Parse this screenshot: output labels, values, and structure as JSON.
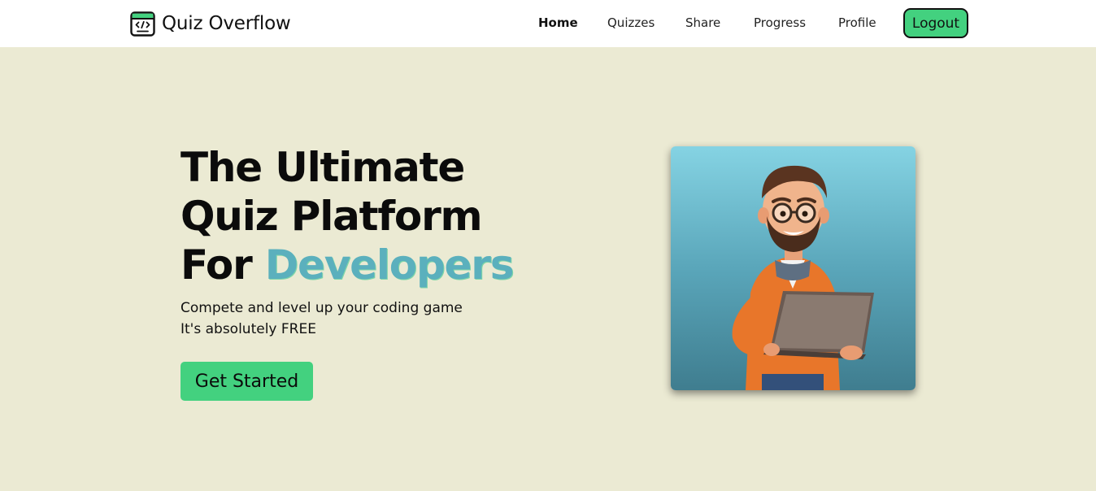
{
  "brand": {
    "name": "Quiz Overflow",
    "icon": "code-window-icon",
    "accent_color": "#43d17f"
  },
  "nav": {
    "items": [
      {
        "label": "Home",
        "active": true
      },
      {
        "label": "Quizzes",
        "active": false
      },
      {
        "label": "Share",
        "active": false
      },
      {
        "label": "Progress",
        "active": false
      },
      {
        "label": "Profile",
        "active": false
      }
    ],
    "logout_label": "Logout"
  },
  "hero": {
    "title_line1": "The Ultimate",
    "title_line2": "Quiz Platform",
    "title_line3_prefix": "For ",
    "title_line3_accent": "Developers",
    "subtitle_line1": "Compete and level up your coding game",
    "subtitle_line2": "It's absolutely FREE",
    "cta_label": "Get Started",
    "image_icon": "developer-illustration-icon"
  },
  "colors": {
    "background": "#ebead3",
    "navbar": "#ffffff",
    "button_green": "#43d17f",
    "accent_text": "#5bb0bd"
  }
}
